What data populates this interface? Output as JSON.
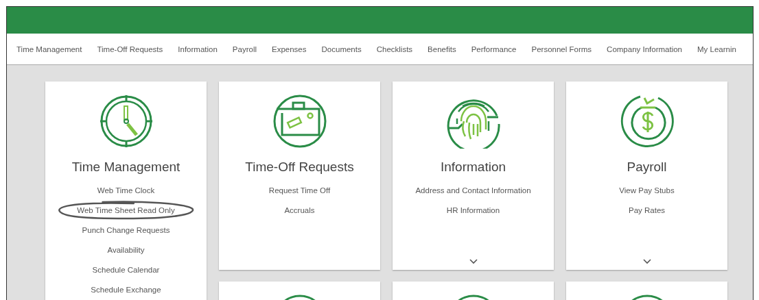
{
  "nav": {
    "items": [
      {
        "label": "Time Management"
      },
      {
        "label": "Time-Off Requests"
      },
      {
        "label": "Information"
      },
      {
        "label": "Payroll"
      },
      {
        "label": "Expenses"
      },
      {
        "label": "Documents"
      },
      {
        "label": "Checklists"
      },
      {
        "label": "Benefits"
      },
      {
        "label": "Performance"
      },
      {
        "label": "Personnel Forms"
      },
      {
        "label": "Company Information"
      },
      {
        "label": "My Learnin"
      }
    ]
  },
  "cards": [
    {
      "title": "Time Management",
      "expandable": false,
      "links": [
        {
          "label": "Web Time Clock",
          "circled": false
        },
        {
          "label": "Web Time Sheet Read Only",
          "circled": true
        },
        {
          "label": "Punch Change Requests",
          "circled": false
        },
        {
          "label": "Availability",
          "circled": false
        },
        {
          "label": "Schedule Calendar",
          "circled": false
        },
        {
          "label": "Schedule Exchange",
          "circled": false
        }
      ]
    },
    {
      "title": "Time-Off Requests",
      "expandable": false,
      "links": [
        {
          "label": "Request Time Off",
          "circled": false
        },
        {
          "label": "Accruals",
          "circled": false
        }
      ]
    },
    {
      "title": "Information",
      "expandable": true,
      "links": [
        {
          "label": "Address and Contact Information",
          "circled": false
        },
        {
          "label": "HR Information",
          "circled": false
        }
      ]
    },
    {
      "title": "Payroll",
      "expandable": true,
      "links": [
        {
          "label": "View Pay Stubs",
          "circled": false
        },
        {
          "label": "Pay Rates",
          "circled": false
        }
      ]
    }
  ]
}
